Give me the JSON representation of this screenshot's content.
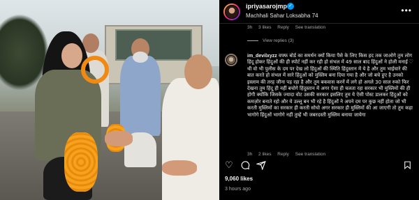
{
  "post": {
    "username": "ipriyasarojmp",
    "location": "Machhali Sahar Loksabha 74"
  },
  "comments": {
    "first_meta": {
      "time": "3h",
      "likes": "3 likes",
      "reply": "Reply",
      "translation": "See translation"
    },
    "view_replies": "View replies (3)",
    "main": {
      "username": "im_devilxyzz",
      "text": "वफ्फ बोर्ड का समर्थन क्यों किया पैसे के लिए किस हद तक जाओगे तुम लोग हिंदू होकर हिंदुओं की ही स्पोर्ट नहीं कर रही हो संभल में 49 साल बाद हिंदुओं ने होली मनाई थी वो भी पुलीस के दम पर देख लो हिंदुओं की स्थिति हिंदुस्तान में ये है और तुम भाईचारे की बात करते हो संभल में सारे हिंदुओं को मुस्लिम बना दिया गया है और जो बचे हुए है उनको इस्लाम की तरह जीना पड़ रहा है और तुम बकवास करनें में लगे हो अगले 30 साल रुको फिर देखना तुम हिंदू ही नहीं बचोगे हिंदुस्तान में अगर ऐसा ही चलता रहा सरकार भी मुस्लिमों की ही होगी क्योंकि जिसके ज्यादा वोट उसकी सरकार इसलिए तुम ये ऐसी पोस्ट डालकर हिंदुओं को कमज़ोर बनाते रहो और ये उल्लू बन भी रहे है हिंदुओं ने अपने दम पर कुछ नहीं होता जो भी करती मुस्लिमों का सरकार ही करती सोचो अगर सरकार ही मुस्लिमों की आ जाएगी तो तुम कहा भागोगे हिंदुओं भागोगे नहीं तुम्हें भी जबरदस्ती मुस्लिम बनाया जायेगा",
      "time": "3h",
      "likes": "2 likes",
      "reply": "Reply",
      "translation": "See translation"
    }
  },
  "engagement": {
    "likes": "9,060 likes",
    "time": "3 hours ago"
  },
  "icons": {
    "like": "heart-icon",
    "comment": "comment-icon",
    "share": "share-icon",
    "save": "bookmark-icon",
    "more": "more-icon",
    "verified": "verified-icon"
  },
  "colors": {
    "background": "#000000",
    "verified": "#0095f6",
    "muted_text": "#a8a8a8"
  }
}
